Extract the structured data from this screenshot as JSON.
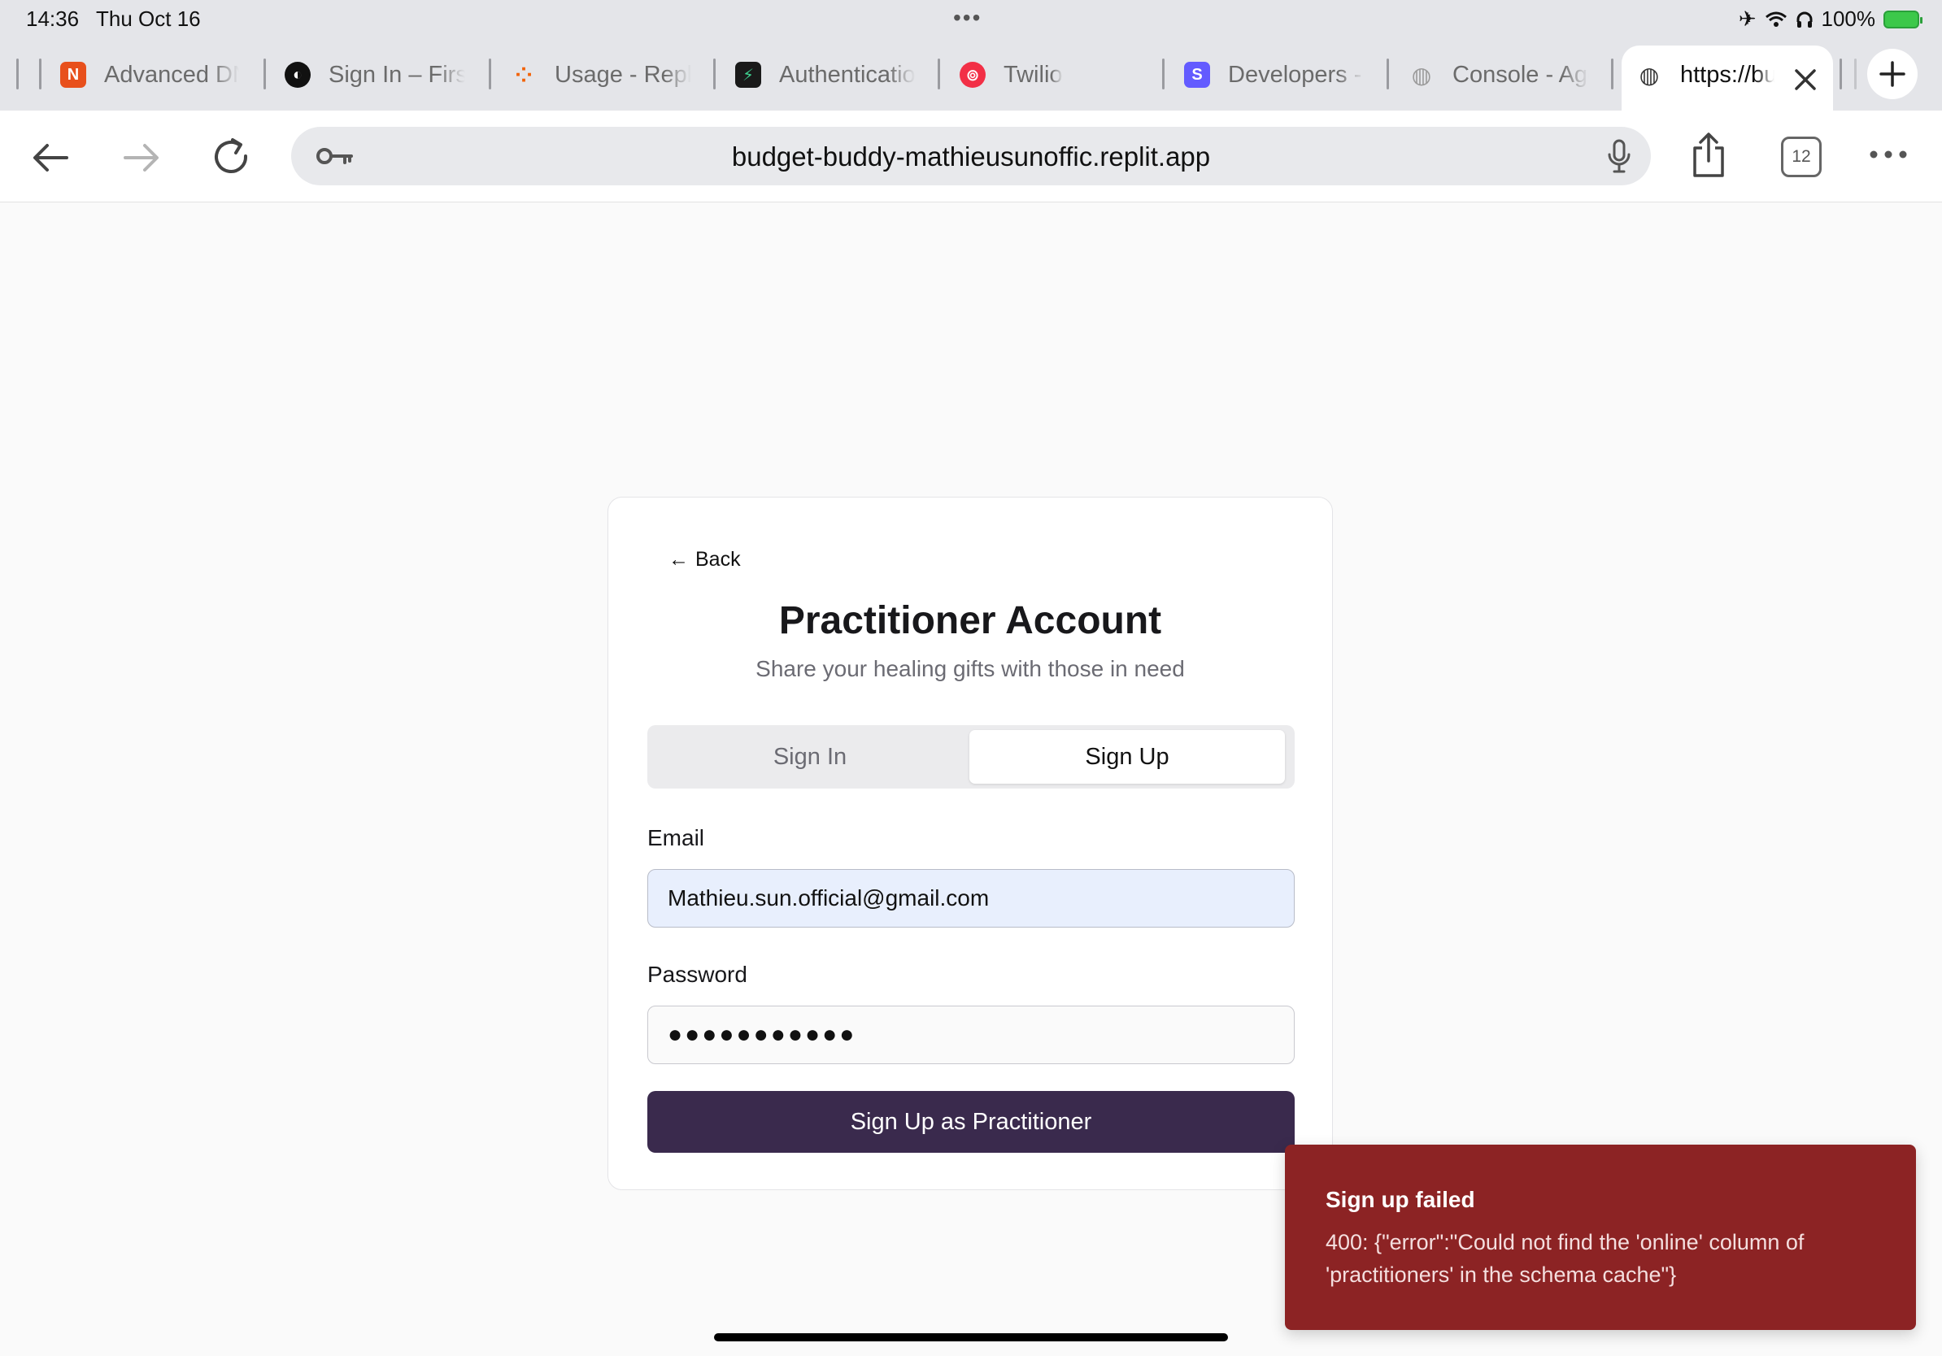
{
  "status": {
    "time": "14:36",
    "date": "Thu Oct 16",
    "battery": "100%"
  },
  "tabs": [
    {
      "title": "Advanced DNS",
      "icon": "namecheap-icon",
      "color": "#e8501c"
    },
    {
      "title": "Sign In – Firstbase",
      "icon": "firstbase-icon",
      "color": "#111111"
    },
    {
      "title": "Usage - Replit",
      "icon": "replit-icon",
      "color": "#f26207"
    },
    {
      "title": "Authentication",
      "icon": "supabase-icon",
      "color": "#1a1a1a"
    },
    {
      "title": "Twilio",
      "icon": "twilio-icon",
      "color": "#f22f46"
    },
    {
      "title": "Developers - Stripe",
      "icon": "stripe-icon",
      "color": "#635bff"
    },
    {
      "title": "Console - Agora",
      "icon": "globe-icon",
      "color": "#9a9a9a"
    }
  ],
  "active_tab": {
    "title": "https://budget-buddy"
  },
  "toolbar": {
    "url": "budget-buddy-mathieusunoffic.replit.app",
    "tab_count": "12"
  },
  "card": {
    "back": "Back",
    "title": "Practitioner Account",
    "subtitle": "Share your healing gifts with those in need",
    "tab_signin": "Sign In",
    "tab_signup": "Sign Up",
    "email_label": "Email",
    "email_value": "Mathieu.sun.official@gmail.com",
    "password_label": "Password",
    "password_value": "●●●●●●●●●●●",
    "submit": "Sign Up as Practitioner"
  },
  "toast": {
    "title": "Sign up failed",
    "message": "400: {\"error\":\"Could not find the 'online' column of 'practitioners' in the schema cache\"}"
  },
  "colors": {
    "accent": "#3a2a4d",
    "error": "#8c2324",
    "email_fill": "#e8effd"
  }
}
